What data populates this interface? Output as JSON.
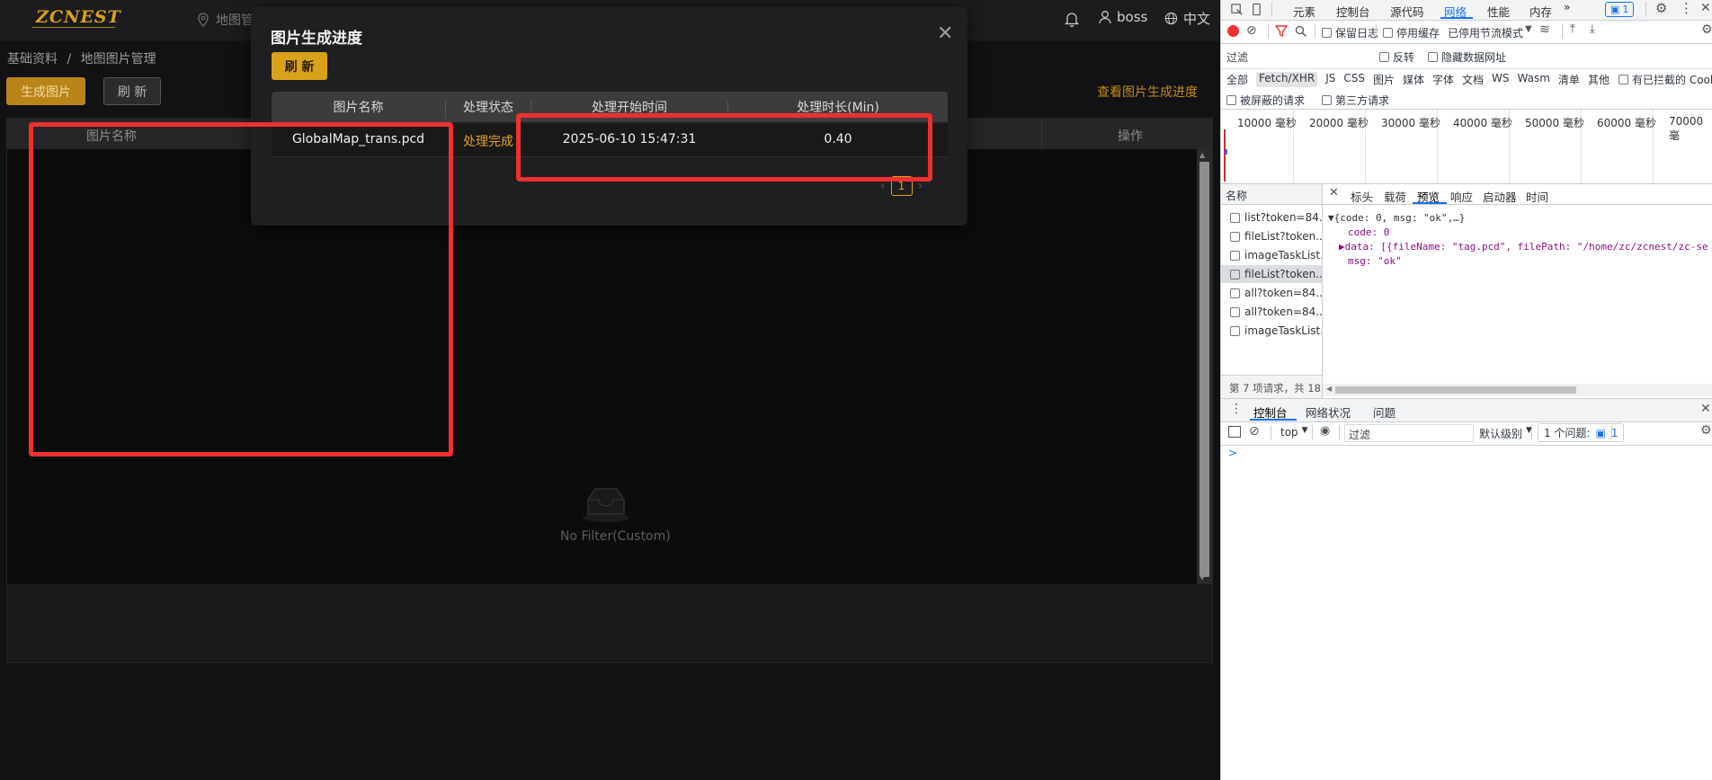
{
  "app": {
    "logo": "ZCNEST",
    "nav_map": "地图管",
    "user": "boss",
    "lang": "中文",
    "breadcrumb": [
      "基础资料",
      "/",
      "地图图片管理"
    ],
    "generate_button": "生成图片",
    "refresh_button": "刷 新",
    "view_progress_link": "查看图片生成进度",
    "table_columns": [
      "图片名称",
      "操作"
    ],
    "empty_text": "No Filter(Custom)"
  },
  "modal": {
    "title": "图片生成进度",
    "refresh_button": "刷 新",
    "columns": [
      "图片名称",
      "处理状态",
      "处理开始时间",
      "处理时长(Min)"
    ],
    "rows": [
      {
        "name": "GlobalMap_trans.pcd",
        "status": "处理完成",
        "start": "2025-06-10 15:47:31",
        "duration": "0.40"
      }
    ],
    "pager": {
      "current": "1"
    },
    "colors": {
      "accent": "#d9a21b",
      "status_done": "#e2a11e"
    }
  },
  "devtools": {
    "tabs": [
      "元素",
      "控制台",
      "源代码",
      "网络",
      "性能",
      "内存"
    ],
    "issues_badge": "1",
    "toolbar": {
      "preserve_log": "保留日志",
      "disable_cache": "停用缓存",
      "throttle": "已停用节流模式"
    },
    "filter_placeholder": "过滤",
    "invert": "反转",
    "hide_data_urls": "隐藏数据网址",
    "types": [
      "全部",
      "Fetch/XHR",
      "JS",
      "CSS",
      "图片",
      "媒体",
      "字体",
      "文档",
      "WS",
      "Wasm",
      "清单",
      "其他"
    ],
    "blocked_cookies": "有已拦截的 Cooki",
    "blocked_requests": "被屏蔽的请求",
    "third_party": "第三方请求",
    "timeline_labels": [
      "10000 毫秒",
      "20000 毫秒",
      "30000 毫秒",
      "40000 毫秒",
      "50000 毫秒",
      "60000 毫秒",
      "70000 毫"
    ],
    "names_header": "名称",
    "requests": [
      "list?token=84...",
      "fileList?token...",
      "imageTaskList...",
      "fileList?token...",
      "all?token=84...",
      "all?token=84...",
      "imageTaskList..."
    ],
    "preview_tabs": [
      "标头",
      "载荷",
      "预览",
      "响应",
      "启动器",
      "时间"
    ],
    "json_lines": [
      "▼{code: 0, msg: \"ok\",…}",
      "code: 0",
      "▶data: [{fileName: \"tag.pcd\", filePath: \"/home/zc/zcnest/zc-se",
      "msg: \"ok\""
    ],
    "status_line": "第 7 项请求，共 18",
    "console_tabs": [
      "控制台",
      "网络状况",
      "问题"
    ],
    "console_context": "top",
    "console_filter_placeholder": "过滤",
    "console_level": "默认级别",
    "console_issues": "1 个问题:",
    "console_issue_count": "1",
    "console_prompt": ">"
  }
}
